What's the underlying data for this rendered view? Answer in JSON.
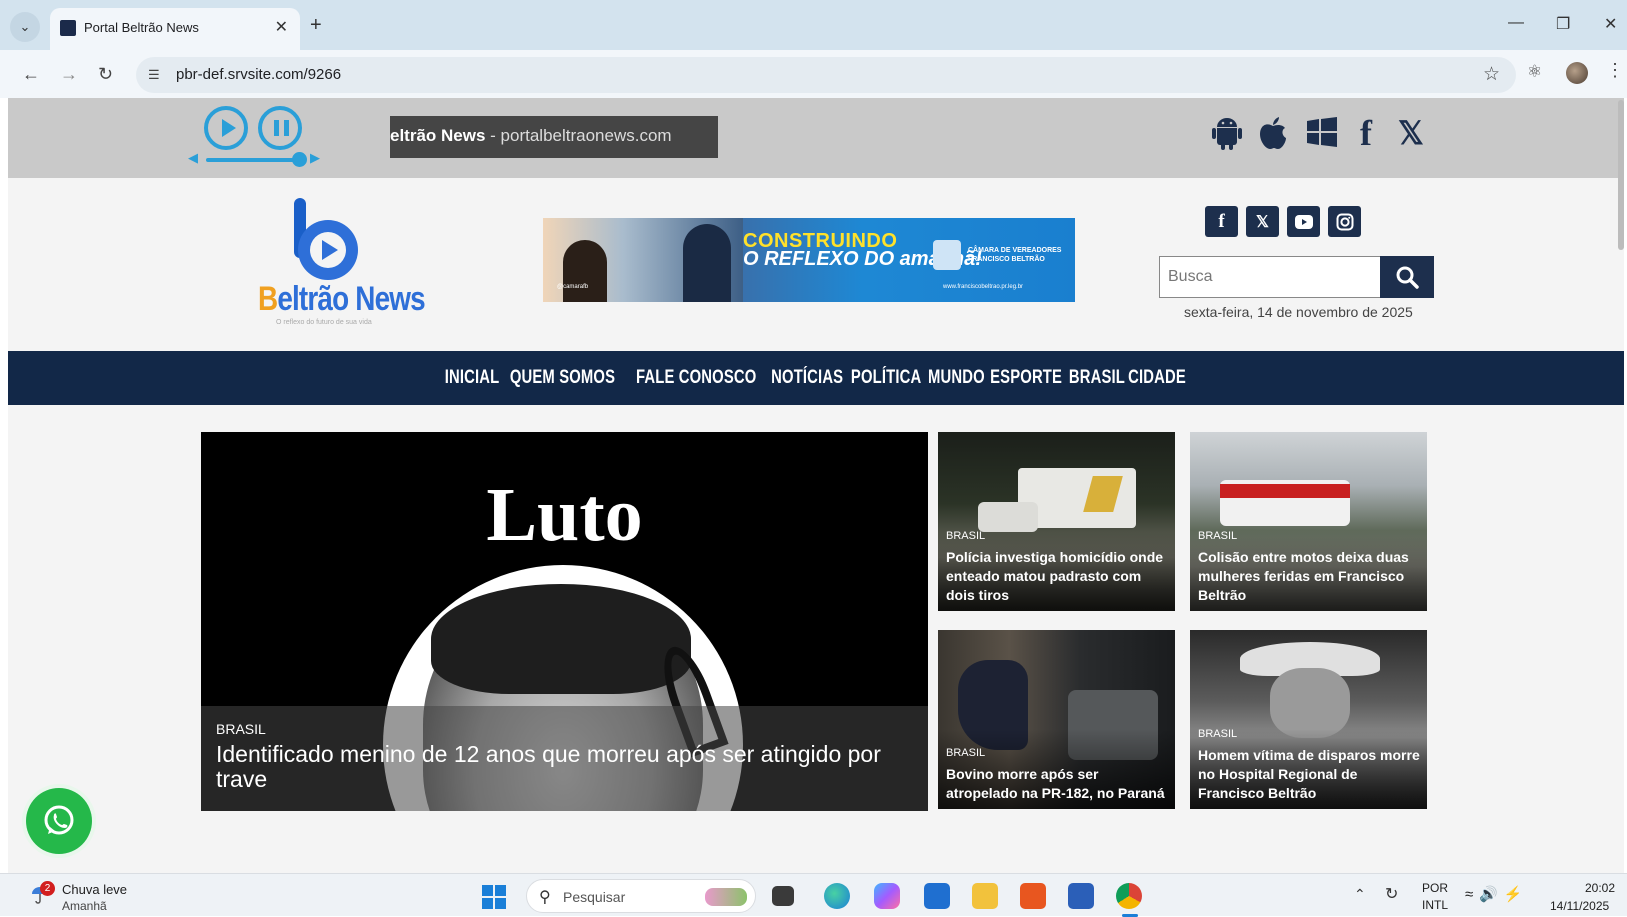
{
  "browser": {
    "tab_title": "Portal Beltrão News",
    "url": "pbr-def.srvsite.com/9266"
  },
  "player": {
    "marquee_bold": "eltrão News",
    "marquee_rest": " - portalbeltraonews.com",
    "accent_color": "#2a9fd8"
  },
  "header": {
    "logo_text_main": "B",
    "logo_text_accent": "eltrão News",
    "logo_tagline": "O reflexo do futuro de sua vida",
    "banner": {
      "line1": "CONSTRUINDO",
      "line2": "O REFLEXO DO amanhã!",
      "org": "CÂMARA DE VEREADORES FRANCISCO BELTRÃO",
      "url": "www.franciscobeltrao.pr.leg.br",
      "handle": "@camarafb"
    },
    "search_placeholder": "Busca",
    "date": "sexta-feira, 14 de novembro de 2025",
    "brand_color": "#1d2f4d"
  },
  "nav": {
    "items": [
      "INICIAL",
      "QUEM SOMOS",
      "FALE CONOSCO",
      "NOTÍCIAS",
      "POLÍTICA",
      "MUNDO",
      "ESPORTE",
      "BRASIL",
      "CIDADE"
    ]
  },
  "news": {
    "feature": {
      "image_text": "Luto",
      "category": "BRASIL",
      "title": "Identificado menino de 12 anos que morreu após ser atingido por trave"
    },
    "cards": [
      {
        "category": "BRASIL",
        "title": "Polícia investiga homicídio onde enteado matou padrasto com dois tiros"
      },
      {
        "category": "BRASIL",
        "title": "Colisão entre motos deixa duas mulheres feridas em Francisco Beltrão"
      },
      {
        "category": "BRASIL",
        "title": "Bovino morre após ser atropelado na PR-182, no Paraná"
      },
      {
        "category": "BRASIL",
        "title": "Homem vítima de disparos morre no Hospital Regional de Francisco Beltrão"
      }
    ]
  },
  "taskbar": {
    "weather_badge": "2",
    "weather_line1": "Chuva leve",
    "weather_line2": "Amanhã",
    "search_text": "Pesquisar",
    "lang_line1": "POR",
    "lang_line2": "INTL",
    "time": "20:02",
    "date": "14/11/2025"
  }
}
